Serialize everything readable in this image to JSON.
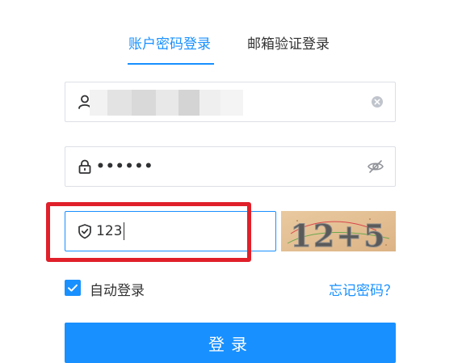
{
  "tabs": [
    {
      "label": "账户密码登录",
      "active": true
    },
    {
      "label": "邮箱验证登录",
      "active": false
    }
  ],
  "username": {
    "icon": "user-icon",
    "clear_icon": "clear-icon",
    "value_redacted": true
  },
  "password": {
    "icon": "lock-icon",
    "value": "••••••",
    "toggle_icon": "eye-off-icon"
  },
  "captcha": {
    "icon": "shield-check-icon",
    "value": "123",
    "image_text": "12+5"
  },
  "remember": {
    "label": "自动登录",
    "checked": true
  },
  "forgot_label": "忘记密码？",
  "login_label": "登录",
  "colors": {
    "primary": "#1890ff",
    "highlight": "#e0202a",
    "border": "#dcdfe6"
  }
}
